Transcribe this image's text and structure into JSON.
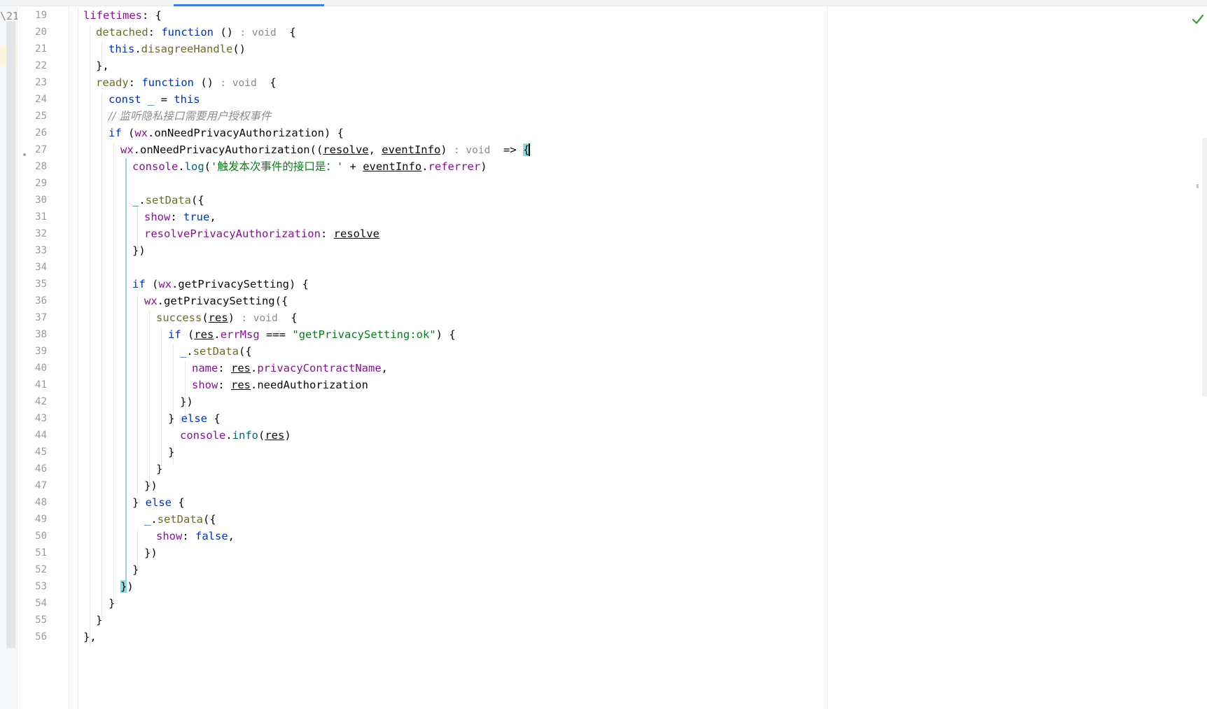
{
  "editor": {
    "gutter_marker": "\\21",
    "line_numbers": [
      "19",
      "20",
      "21",
      "22",
      "23",
      "24",
      "25",
      "26",
      "27",
      "28",
      "29",
      "30",
      "31",
      "32",
      "33",
      "34",
      "35",
      "36",
      "37",
      "38",
      "39",
      "40",
      "41",
      "42",
      "43",
      "44",
      "45",
      "46",
      "47",
      "48",
      "49",
      "50",
      "51",
      "52",
      "53",
      "54",
      "55",
      "56"
    ],
    "code": {
      "l19": {
        "prop": "lifetimes",
        "rest": ": {"
      },
      "l20": {
        "name": "detached",
        "sep": ": ",
        "kw": "function",
        "paren": " () ",
        "hint": ": void",
        "brace": "  {"
      },
      "l21": {
        "kw": "this",
        "dot": ".",
        "meth": "disagreeHandle",
        "rest": "()"
      },
      "l22": {
        "text": "},"
      },
      "l23": {
        "name": "ready",
        "sep": ": ",
        "kw": "function",
        "paren": " () ",
        "hint": ": void",
        "brace": "  {"
      },
      "l24": {
        "kw1": "const",
        "var": " _ ",
        "eq": "= ",
        "kw2": "this"
      },
      "l25": {
        "comment": "// 监听隐私接口需要用户授权事件"
      },
      "l26": {
        "kw": "if",
        "open": " (",
        "obj": "wx",
        "rest": ".onNeedPrivacyAuthorization) {"
      },
      "l27": {
        "obj": "wx",
        "call": ".onNeedPrivacyAuthorization((",
        "p1": "resolve",
        "comma": ", ",
        "p2": "eventInfo",
        "close": ") ",
        "hint": ": void",
        "arrow": "  => ",
        "brace": "{"
      },
      "l28": {
        "obj": "console",
        "dot": ".",
        "meth": "log",
        "open": "(",
        "str": "'触发本次事件的接口是：'",
        "plus": " + ",
        "param": "eventInfo",
        "dot2": ".",
        "prop": "referrer",
        "close": ")"
      },
      "l30": {
        "var": "_",
        "dot": ".",
        "meth": "setData",
        "rest": "({"
      },
      "l31": {
        "prop": "show",
        "sep": ": ",
        "kw": "true",
        "rest": ","
      },
      "l32": {
        "prop": "resolvePrivacyAuthorization",
        "sep": ": ",
        "param": "resolve"
      },
      "l33": {
        "text": "})"
      },
      "l35": {
        "kw": "if",
        "open": " (",
        "obj": "wx",
        "rest": ".getPrivacySetting) {"
      },
      "l36": {
        "obj": "wx",
        "rest": ".getPrivacySetting({"
      },
      "l37": {
        "name": "success",
        "open": "(",
        "param": "res",
        "close": ") ",
        "hint": ": void",
        "brace": "  {"
      },
      "l38": {
        "kw": "if",
        "open": " (",
        "param": "res",
        "dot": ".",
        "prop": "errMsg",
        "op": " === ",
        "str": "\"getPrivacySetting:ok\"",
        "rest": ") {"
      },
      "l39": {
        "var": "_",
        "dot": ".",
        "meth": "setData",
        "rest": "({"
      },
      "l40": {
        "prop": "name",
        "sep": ": ",
        "param": "res",
        "dot": ".",
        "prop2": "privacyContractName",
        "rest": ","
      },
      "l41": {
        "prop": "show",
        "sep": ": ",
        "param": "res",
        "rest": ".needAuthorization"
      },
      "l42": {
        "text": "})"
      },
      "l43": {
        "pre": "} ",
        "kw": "else",
        "rest": " {"
      },
      "l44": {
        "obj": "console",
        "dot": ".",
        "meth": "info",
        "open": "(",
        "param": "res",
        "close": ")"
      },
      "l45": {
        "text": "}"
      },
      "l46": {
        "text": "}"
      },
      "l47": {
        "text": "})"
      },
      "l48": {
        "pre": "} ",
        "kw": "else",
        "rest": " {"
      },
      "l49": {
        "var": "_",
        "dot": ".",
        "meth": "setData",
        "rest": "({"
      },
      "l50": {
        "prop": "show",
        "sep": ": ",
        "kw": "false",
        "rest": ","
      },
      "l51": {
        "text": "})"
      },
      "l52": {
        "text": "}"
      },
      "l53": {
        "brace": "}",
        "rest": ")"
      },
      "l54": {
        "text": "}"
      },
      "l55": {
        "text": "}"
      },
      "l56": {
        "text": "},"
      }
    }
  },
  "colors": {
    "keyword": "#0033b3",
    "property": "#871094",
    "string": "#067d17",
    "method": "#00627a",
    "comment": "#8c8c8c",
    "brace_highlight": "#93d9d9"
  },
  "status": {
    "inspection_icon": "check-icon"
  }
}
